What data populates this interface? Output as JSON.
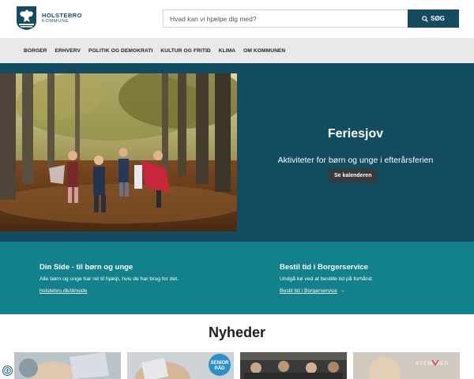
{
  "header": {
    "logo_name": "HOLSTEBRO",
    "logo_sub": "KOMMUNE",
    "search_placeholder": "Hvad kan vi hjælpe dig med?",
    "search_button": "SØG"
  },
  "nav": {
    "items": [
      "BORGER",
      "ERHVERV",
      "POLITIK OG DEMOKRATI",
      "KULTUR OG FRITID",
      "KLIMA",
      "OM KOMMUNEN"
    ]
  },
  "hero": {
    "title": "Feriesjov",
    "subtitle": "Aktiviteter for børn og unge i efterårsferien",
    "button": "Se kalenderen"
  },
  "band": {
    "left": {
      "title": "Din Side - til børn og unge",
      "text": "Alle børn og unge har ret til hjælp, hvis de har brug for det.",
      "link": "holstebro.dk/dinside"
    },
    "right": {
      "title": "Bestil tid i Borgerservice",
      "text": "Undgå kø ved at bestille tid på forhånd.",
      "link": "Bestil tid i Borgerservice",
      "arrow": "→"
    }
  },
  "news": {
    "title": "Nyheder",
    "card2_badge_line1": "SENIOR",
    "card2_badge_line2": "RÅD",
    "card4_watermark": "STEM MED"
  },
  "colors": {
    "brand_dark": "#134c60",
    "teal_band": "#12818c",
    "nav_bg": "#e9e9e9",
    "button_dark": "#3a3a3a"
  },
  "icons": {
    "logo": "coat-of-arms-icon",
    "search": "search-icon",
    "accessibility": "accessibility-icon"
  }
}
